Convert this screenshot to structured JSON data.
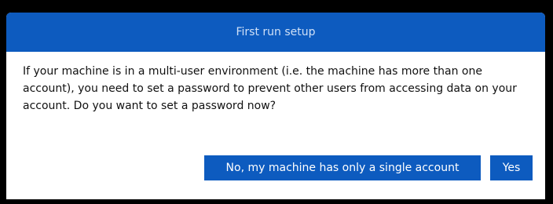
{
  "dialog": {
    "title": "First run setup",
    "message": "If your machine is in a multi-user environment (i.e. the machine has more than one account), you need to set a password to prevent other users from accessing data on your account. Do you want to set a password now?",
    "buttons": {
      "no_label": "No, my machine has only a single account",
      "yes_label": "Yes"
    }
  },
  "colors": {
    "accent": "#0d5bbf",
    "title_text": "#cfe0f7",
    "background": "#000000",
    "dialog_bg": "#ffffff"
  }
}
